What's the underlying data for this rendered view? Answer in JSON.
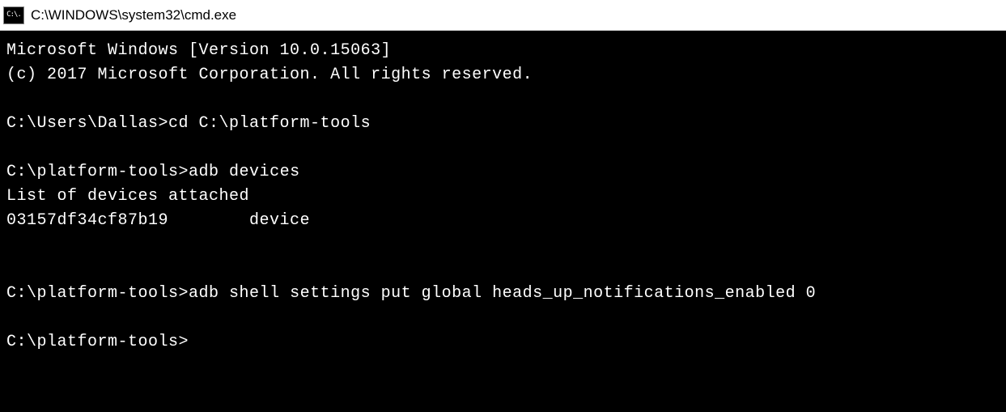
{
  "window": {
    "title": "C:\\WINDOWS\\system32\\cmd.exe",
    "icon_label": "C:\\."
  },
  "terminal": {
    "banner_line1": "Microsoft Windows [Version 10.0.15063]",
    "banner_line2": "(c) 2017 Microsoft Corporation. All rights reserved.",
    "entries": [
      {
        "prompt": "C:\\Users\\Dallas>",
        "command": "cd C:\\platform-tools",
        "output": []
      },
      {
        "prompt": "C:\\platform-tools>",
        "command": "adb devices",
        "output": [
          "List of devices attached",
          "03157df34cf87b19        device"
        ]
      },
      {
        "prompt": "C:\\platform-tools>",
        "command": "adb shell settings put global heads_up_notifications_enabled 0",
        "output": []
      },
      {
        "prompt": "C:\\platform-tools>",
        "command": "",
        "output": []
      }
    ]
  }
}
